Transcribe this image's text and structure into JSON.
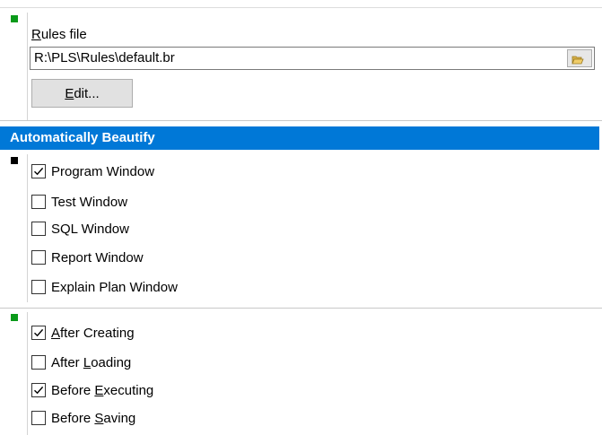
{
  "rules": {
    "label_underlined": "R",
    "label_rest": "ules file",
    "file_path": "R:\\PLS\\Rules\\default.br",
    "browse_icon": "folder-open-icon",
    "edit_button_underlined": "E",
    "edit_button_rest": "dit..."
  },
  "auto_beautify": {
    "header": "Automatically Beautify",
    "windows": [
      {
        "label": "Program Window",
        "checked": true
      },
      {
        "label": "Test Window",
        "checked": false
      },
      {
        "label": "SQL Window",
        "checked": false
      },
      {
        "label": "Report Window",
        "checked": false
      },
      {
        "label": "Explain Plan Window",
        "checked": false
      }
    ],
    "actions": [
      {
        "pre": "",
        "u": "A",
        "post": "fter Creating",
        "checked": true
      },
      {
        "pre": "After ",
        "u": "L",
        "post": "oading",
        "checked": false
      },
      {
        "pre": "Before ",
        "u": "E",
        "post": "xecuting",
        "checked": true
      },
      {
        "pre": "Before ",
        "u": "S",
        "post": "aving",
        "checked": false
      }
    ]
  },
  "colors": {
    "header_bg": "#0078d7",
    "marker_green": "#0a9a1a",
    "marker_black": "#000000"
  }
}
